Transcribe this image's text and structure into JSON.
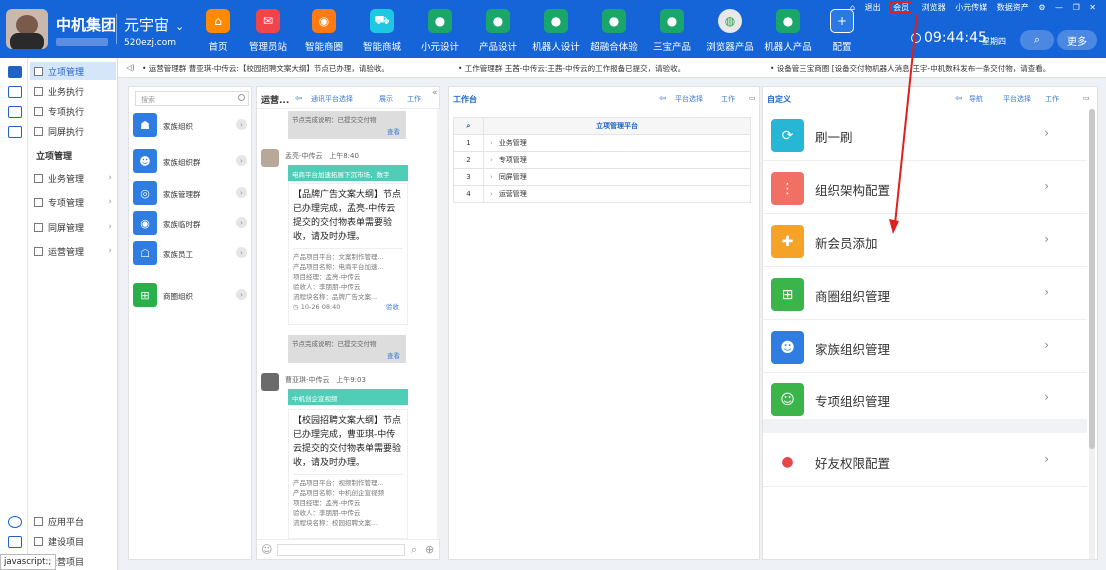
{
  "header": {
    "company": "中机集团",
    "brand": "元宇宙",
    "brand_sub": "520ezj.com",
    "nav": [
      {
        "label": "首页",
        "color": "#ff8a00",
        "glyph": "⌂",
        "icon": "home-icon"
      },
      {
        "label": "管理员站",
        "color": "#f0464b",
        "glyph": "✉",
        "icon": "admin-icon"
      },
      {
        "label": "智能商圈",
        "color": "#ff7a12",
        "glyph": "◉",
        "icon": "smart-circle-icon"
      },
      {
        "label": "智能商城",
        "color": "#1ec8e0",
        "glyph": "⛟",
        "icon": "mall-cart-icon"
      },
      {
        "label": "小元设计",
        "color": "#1aa66a",
        "glyph": "●",
        "icon": "globe-icon"
      },
      {
        "label": "产品设计",
        "color": "#1aa66a",
        "glyph": "●",
        "icon": "globe-icon"
      },
      {
        "label": "机器人设计",
        "color": "#1aa66a",
        "glyph": "●",
        "icon": "globe-icon"
      },
      {
        "label": "超融合体验",
        "color": "#1aa66a",
        "glyph": "●",
        "icon": "globe-icon"
      },
      {
        "label": "三宝产品",
        "color": "#1aa66a",
        "glyph": "●",
        "icon": "globe-icon"
      },
      {
        "label": "浏览器产品",
        "color": "#e8e8e8",
        "glyph": "◍",
        "icon": "browser-icon"
      },
      {
        "label": "机器人产品",
        "color": "#1aa66a",
        "glyph": "●",
        "icon": "globe-icon"
      },
      {
        "label": "配置",
        "color": "#2a78e4",
        "glyph": "+",
        "icon": "plus-icon"
      }
    ],
    "topmenu": [
      "退出",
      "会员",
      "浏览器",
      "小元传媒",
      "数据资产"
    ],
    "time": "09:44:45",
    "weekday": "星期四",
    "more": "更多"
  },
  "notices": [
    "• 运营管理群 曹亚琪-中传云:【校园招聘文案大纲】节点已办理，请验收。",
    "• 工作管理群 王茜-中传云:王茜-中传云的工作报备已提交，请验收。",
    "• 设备管三宝商圈 [设备交付物机器人消息]王宇-中机数科发布一条交付物，请查看。"
  ],
  "sidebar": {
    "top": [
      {
        "label": "立项管理",
        "active": true
      },
      {
        "label": "业务执行"
      },
      {
        "label": "专项执行"
      },
      {
        "label": "同屏执行"
      }
    ],
    "section_title": "立项管理",
    "groups": [
      "业务管理",
      "专项管理",
      "同屏管理",
      "运营管理"
    ],
    "bottom": [
      "应用平台",
      "建设项目",
      "运营项目"
    ],
    "status": "javascript:;"
  },
  "groups_panel": {
    "search_placeholder": "搜索",
    "items": [
      {
        "label": "家族组织",
        "color": "#2f7de1",
        "icon": "family-org-icon"
      },
      {
        "label": "家族组织群",
        "color": "#2f7de1",
        "icon": "user-group-icon"
      },
      {
        "label": "家族管理群",
        "color": "#2f7de1",
        "icon": "manage-group-icon"
      },
      {
        "label": "家族临时群",
        "color": "#2f7de1",
        "icon": "temp-group-icon"
      },
      {
        "label": "家族员工",
        "color": "#2f7de1",
        "icon": "staff-icon"
      },
      {
        "label": "商圈组织",
        "color": "#29b04a",
        "icon": "business-org-icon"
      }
    ]
  },
  "chat": {
    "title": "运营...",
    "links": [
      "通讯平台选择",
      "展示",
      "工作"
    ],
    "node_status": "节点完成说明：已提交交付物",
    "check": "查看",
    "messages": [
      {
        "sender": "孟亮-中传云",
        "time": "上午8:40",
        "bar": "电商平台加速拓展下沉市场，数字",
        "body": "【品牌广告文案大纲】节点已办理完成，孟亮-中传云提交的交付物表单需要验收，请及时办理。",
        "details": [
          "产品项目平台：文案制作管理...",
          "产品项目名称：电商平台加速...",
          "项目经理：孟亮-中传云",
          "验收人：李朋朋-中传云",
          "流程块名称：品牌广告文案..."
        ],
        "stamp": "10-26 08:40",
        "action": "验收"
      },
      {
        "sender": "曹亚琪-中传云",
        "time": "上午9:03",
        "bar": "中机创企宣视频",
        "body": "【校园招聘文案大纲】节点已办理完成，曹亚琪-中传云提交的交付物表单需要验收，请及时办理。",
        "details": [
          "产品项目平台：视频制作管理...",
          "产品项目名称：中机创企宣视频",
          "项目经理：孟亮-中传云",
          "验收人：李朋朋-中传云",
          "流程块名称：校园招聘文案..."
        ]
      }
    ]
  },
  "workspace": {
    "title": "工作台",
    "links": [
      "平台选择",
      "工作"
    ],
    "table_header": "立项管理平台",
    "rows": [
      {
        "n": "1",
        "label": "业务管理"
      },
      {
        "n": "2",
        "label": "专项管理"
      },
      {
        "n": "3",
        "label": "同屏管理"
      },
      {
        "n": "4",
        "label": "运营管理"
      }
    ]
  },
  "custom": {
    "title": "自定义",
    "links": [
      "导航",
      "平台选择",
      "工作"
    ],
    "items": [
      {
        "label": "刷一刷",
        "color": "#25b7d3",
        "glyph": "⟳",
        "icon": "refresh-icon"
      },
      {
        "label": "组织架构配置",
        "color": "#f07065",
        "glyph": "⋮",
        "icon": "org-structure-icon"
      },
      {
        "label": "新会员添加",
        "color": "#f4a228",
        "glyph": "✚",
        "icon": "new-member-icon"
      },
      {
        "label": "商圈组织管理",
        "color": "#3bb44a",
        "glyph": "⊞",
        "icon": "business-org-icon"
      },
      {
        "label": "家族组织管理",
        "color": "#2f7de1",
        "glyph": "☻",
        "icon": "family-org-icon"
      },
      {
        "label": "专项组织管理",
        "color": "#3bb44a",
        "glyph": "☺",
        "icon": "special-org-icon"
      },
      {
        "label": "好友权限配置",
        "color": "#ffffff",
        "glyph": "●",
        "icon": "friend-permission-icon"
      }
    ]
  }
}
